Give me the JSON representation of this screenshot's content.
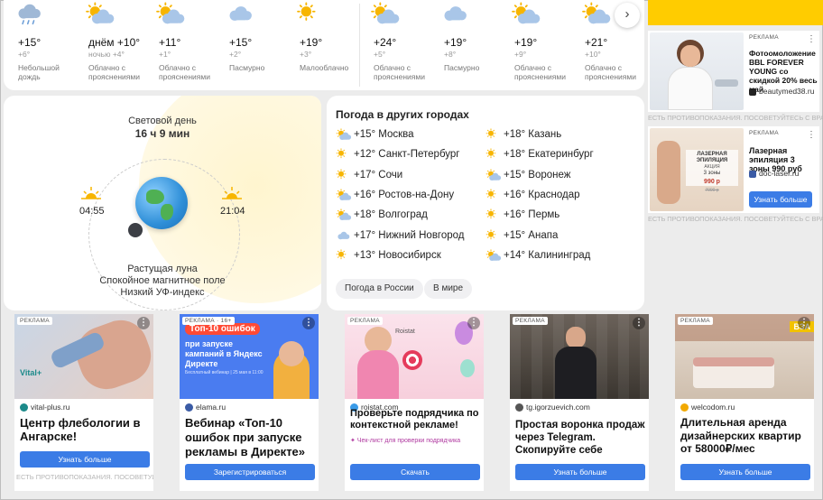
{
  "forecast": {
    "days": [
      {
        "icon": "rain-cloud-icon",
        "temp": "+15°",
        "night": "+6°",
        "cond": "Небольшой дождь"
      },
      {
        "icon": "sun-cloud-icon",
        "temp": "днём +10°",
        "night": "ночью +4°",
        "cond": "Облачно с прояснениями"
      },
      {
        "icon": "sun-cloud-icon",
        "temp": "+11°",
        "night": "+1°",
        "cond": "Облачно с прояснениями"
      },
      {
        "icon": "cloud-icon",
        "temp": "+15°",
        "night": "+2°",
        "cond": "Пасмурно"
      },
      {
        "icon": "sun-icon",
        "temp": "+19°",
        "night": "+3°",
        "cond": "Малооблачно"
      },
      {
        "icon": "sun-cloud-icon",
        "temp": "+24°",
        "night": "+5°",
        "cond": "Облачно с прояснениями"
      },
      {
        "icon": "cloud-icon",
        "temp": "+19°",
        "night": "+8°",
        "cond": "Пасмурно"
      },
      {
        "icon": "sun-cloud-icon",
        "temp": "+19°",
        "night": "+9°",
        "cond": "Облачно с прояснениями"
      },
      {
        "icon": "sun-cloud-icon",
        "temp": "+21°",
        "night": "+10°",
        "cond": "Облачно с прояснениями"
      }
    ],
    "next_label": "›"
  },
  "sun": {
    "daylight_label": "Световой день",
    "daylight_value": "16 ч 9 мин",
    "sunrise": "04:55",
    "sunset": "21:04",
    "moon_phase": "Растущая луна",
    "magnetic": "Спокойное магнитное поле",
    "uv": "Низкий УФ-индекс"
  },
  "cities": {
    "title": "Погода в других городах",
    "left": [
      {
        "icon": "sun-cloud-icon",
        "text": "+15° Москва"
      },
      {
        "icon": "sun-icon",
        "text": "+12° Санкт-Петербург"
      },
      {
        "icon": "sun-icon",
        "text": "+17° Сочи"
      },
      {
        "icon": "sun-cloud-icon",
        "text": "+16° Ростов-на-Дону"
      },
      {
        "icon": "sun-cloud-icon",
        "text": "+18° Волгоград"
      },
      {
        "icon": "cloud-icon",
        "text": "+17° Нижний Новгород"
      },
      {
        "icon": "sun-icon",
        "text": "+13° Новосибирск"
      }
    ],
    "right": [
      {
        "icon": "sun-icon",
        "text": "+18° Казань"
      },
      {
        "icon": "sun-icon",
        "text": "+18° Екатеринбург"
      },
      {
        "icon": "sun-cloud-icon",
        "text": "+15° Воронеж"
      },
      {
        "icon": "sun-icon",
        "text": "+16° Краснодар"
      },
      {
        "icon": "sun-icon",
        "text": "+16° Пермь"
      },
      {
        "icon": "sun-icon",
        "text": "+15° Анапа"
      },
      {
        "icon": "sun-cloud-icon",
        "text": "+14° Калининград"
      }
    ],
    "btn_russia": "Погода в России",
    "btn_world": "В мире"
  },
  "right_ads": [
    {
      "label": "РЕКЛАМА",
      "title": "Фотоомоложение BBL FOREVER YOUNG со скидкой 20% весь май",
      "domain": "beautymed38.ru"
    },
    {
      "label": "РЕКЛАМА",
      "title": "Лазерная эпиляция 3 зоны 990 руб",
      "domain": "doc-laser.ru",
      "button": "Узнать больше",
      "img_lines": [
        "ЛАЗЕРНАЯ ЭПИЛЯЦИЯ",
        "АКЦИЯ",
        "3 зоны",
        "990 р",
        "7000 р"
      ]
    }
  ],
  "warning": "ЕСТЬ ПРОТИВОПОКАЗАНИЯ. ПОСОВЕТУЙТЕСЬ С ВРАЧОМ",
  "bottom_ads": [
    {
      "label": "РЕКЛАМА",
      "domain": "vital-plus.ru",
      "title": "Центр флебологии в Ангарске!",
      "button": "Узнать больше",
      "logo": "Vital+",
      "warning": "ЕСТЬ ПРОТИВОПОКАЗАНИЯ. ПОСОВЕТУЙТЕСЬ С ВРАЧОМ"
    },
    {
      "label": "РЕКЛАМА · 16+",
      "domain": "elama.ru",
      "title": "Вебинар «Топ-10 ошибок при запуске рекламы в Директе»",
      "button": "Зарегистрироваться",
      "img_badge": "Топ-10 ошибок",
      "img_text": "при запуске кампаний в Яндекс Директе",
      "img_small": "Бесплатный вебинар | 25 мая в 11:00"
    },
    {
      "label": "РЕКЛАМА",
      "domain": "roistat.com",
      "title": "Проверьте подрядчика по контекстной рекламе!",
      "sub": "Чек-лист для проверки подрядчика",
      "button": "Скачать",
      "img_logo": "Roistat"
    },
    {
      "label": "РЕКЛАМА",
      "domain": "tg.igorzuevich.com",
      "title": "Простая воронка продаж через Telegram. Скопируйте себе",
      "button": "Узнать больше"
    },
    {
      "label": "РЕКЛАМА",
      "domain": "welcodom.ru",
      "title": "Длительная аренда дизайнерских квартир от 58000₽/мес",
      "button": "Узнать больше",
      "img_badge": "ВЗА"
    }
  ]
}
